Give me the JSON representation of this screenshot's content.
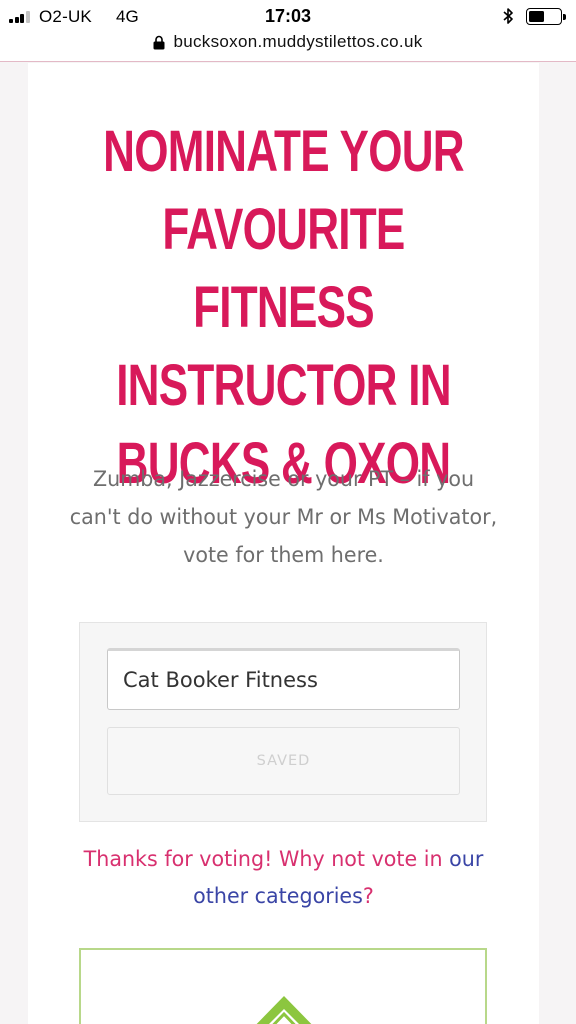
{
  "status_bar": {
    "carrier": "O2-UK",
    "network": "4G",
    "time": "17:03"
  },
  "browser": {
    "url": "bucksoxon.muddystilettos.co.uk"
  },
  "page": {
    "headline": "Nominate your favourite fitness instructor in Bucks & Oxon",
    "intro": "Zumba, Jazzercise or your PT – if you can't do without your Mr or Ms Motivator, vote for them here.",
    "form": {
      "nomination_value": "Cat Booker Fitness",
      "button_label": "SAVED"
    },
    "thanks_text": "Thanks for voting! Why not vote in ",
    "thanks_link": "our other categories",
    "thanks_end": "?"
  },
  "colors": {
    "headline": "#d8195a",
    "link": "#3a45a6",
    "thanks": "#d8306f",
    "promo_border": "#b8d88a",
    "logo_green": "#8cc63f"
  }
}
